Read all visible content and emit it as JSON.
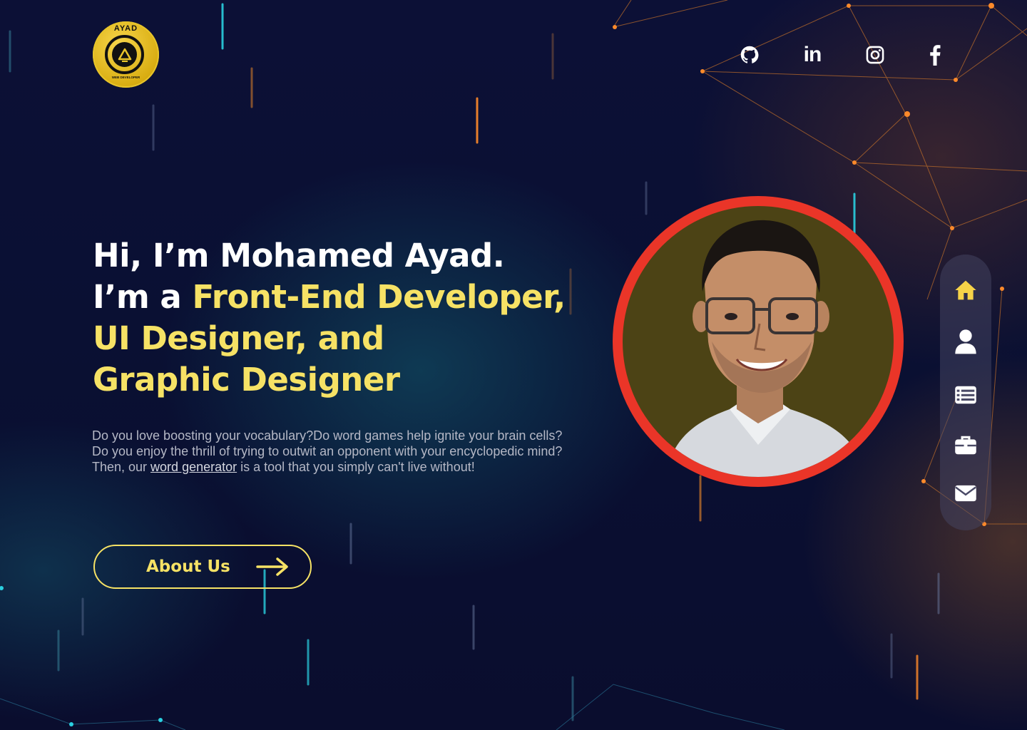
{
  "logo": {
    "top_text": "AYAD",
    "bottom_text": "WEB DEVELOPER",
    "icon": "ayad-logo-icon"
  },
  "social": [
    {
      "icon": "github-icon"
    },
    {
      "icon": "linkedin-icon",
      "glyph": "in"
    },
    {
      "icon": "instagram-icon"
    },
    {
      "icon": "facebook-icon",
      "glyph": "f"
    }
  ],
  "hero": {
    "line1": "Hi, I’m Mohamed Ayad.",
    "line2_prefix": "I’m a ",
    "line2_highlight": "Front-End Developer,",
    "line3": "UI Designer, and",
    "line4": "Graphic Designer",
    "description_before": "Do you love boosting your vocabulary?Do word games help ignite your brain cells?Do you enjoy the thrill of trying to outwit an opponent with your encyclopedic mind?Then, our ",
    "description_link": "word generator",
    "description_after": " is a tool that you simply can't live without!",
    "button_label": "About Us"
  },
  "sidenav": {
    "active": "home",
    "items": [
      {
        "name": "home",
        "icon": "home-icon"
      },
      {
        "name": "about",
        "icon": "user-icon"
      },
      {
        "name": "resume",
        "icon": "list-icon"
      },
      {
        "name": "portfolio",
        "icon": "briefcase-icon"
      },
      {
        "name": "contact",
        "icon": "envelope-icon"
      }
    ]
  },
  "colors": {
    "accent": "#f6e265",
    "avatar_ring": "#ea3528",
    "background": "#0b1034",
    "active_icon": "#f6d348"
  }
}
